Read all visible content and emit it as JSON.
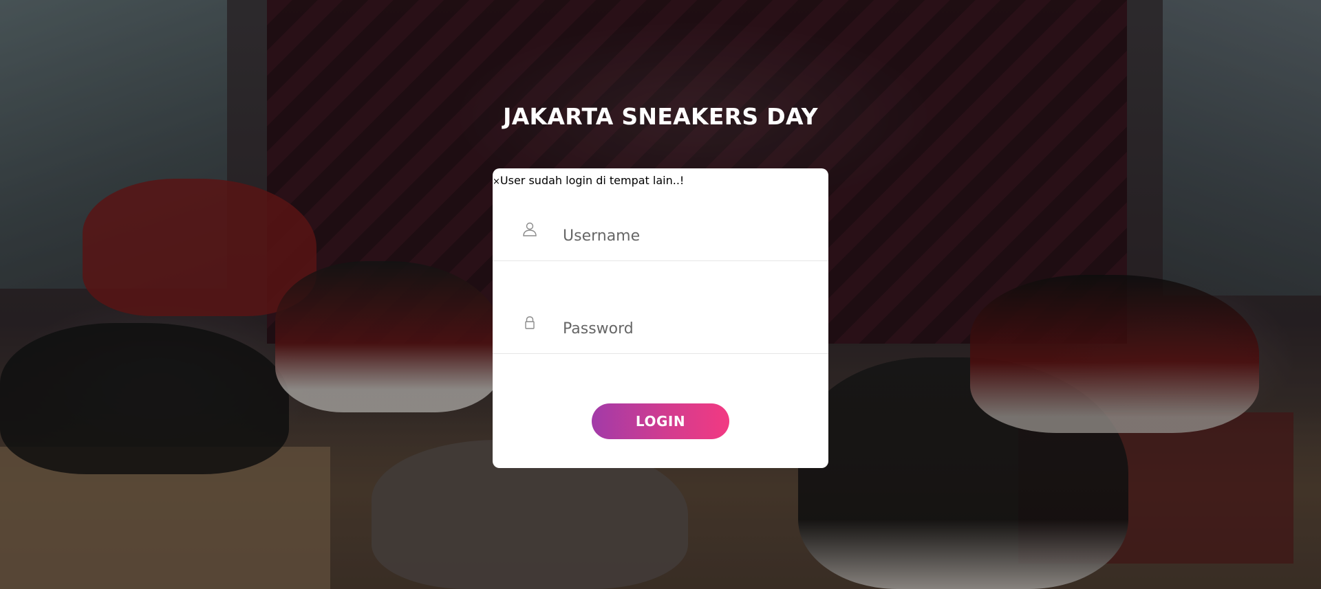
{
  "page": {
    "title": "JAKARTA SNEAKERS DAY"
  },
  "alert": {
    "close_symbol": "×",
    "message": "User sudah login di tempat lain..!"
  },
  "form": {
    "username": {
      "placeholder": "Username",
      "value": "",
      "icon": "user-icon"
    },
    "password": {
      "placeholder": "Password",
      "value": "",
      "icon": "lock-icon"
    },
    "login_label": "LOGIN"
  },
  "colors": {
    "button_gradient_start": "#a23ba8",
    "button_gradient_end": "#f23a82",
    "card_background": "#ffffff",
    "title_text": "#ffffff"
  }
}
